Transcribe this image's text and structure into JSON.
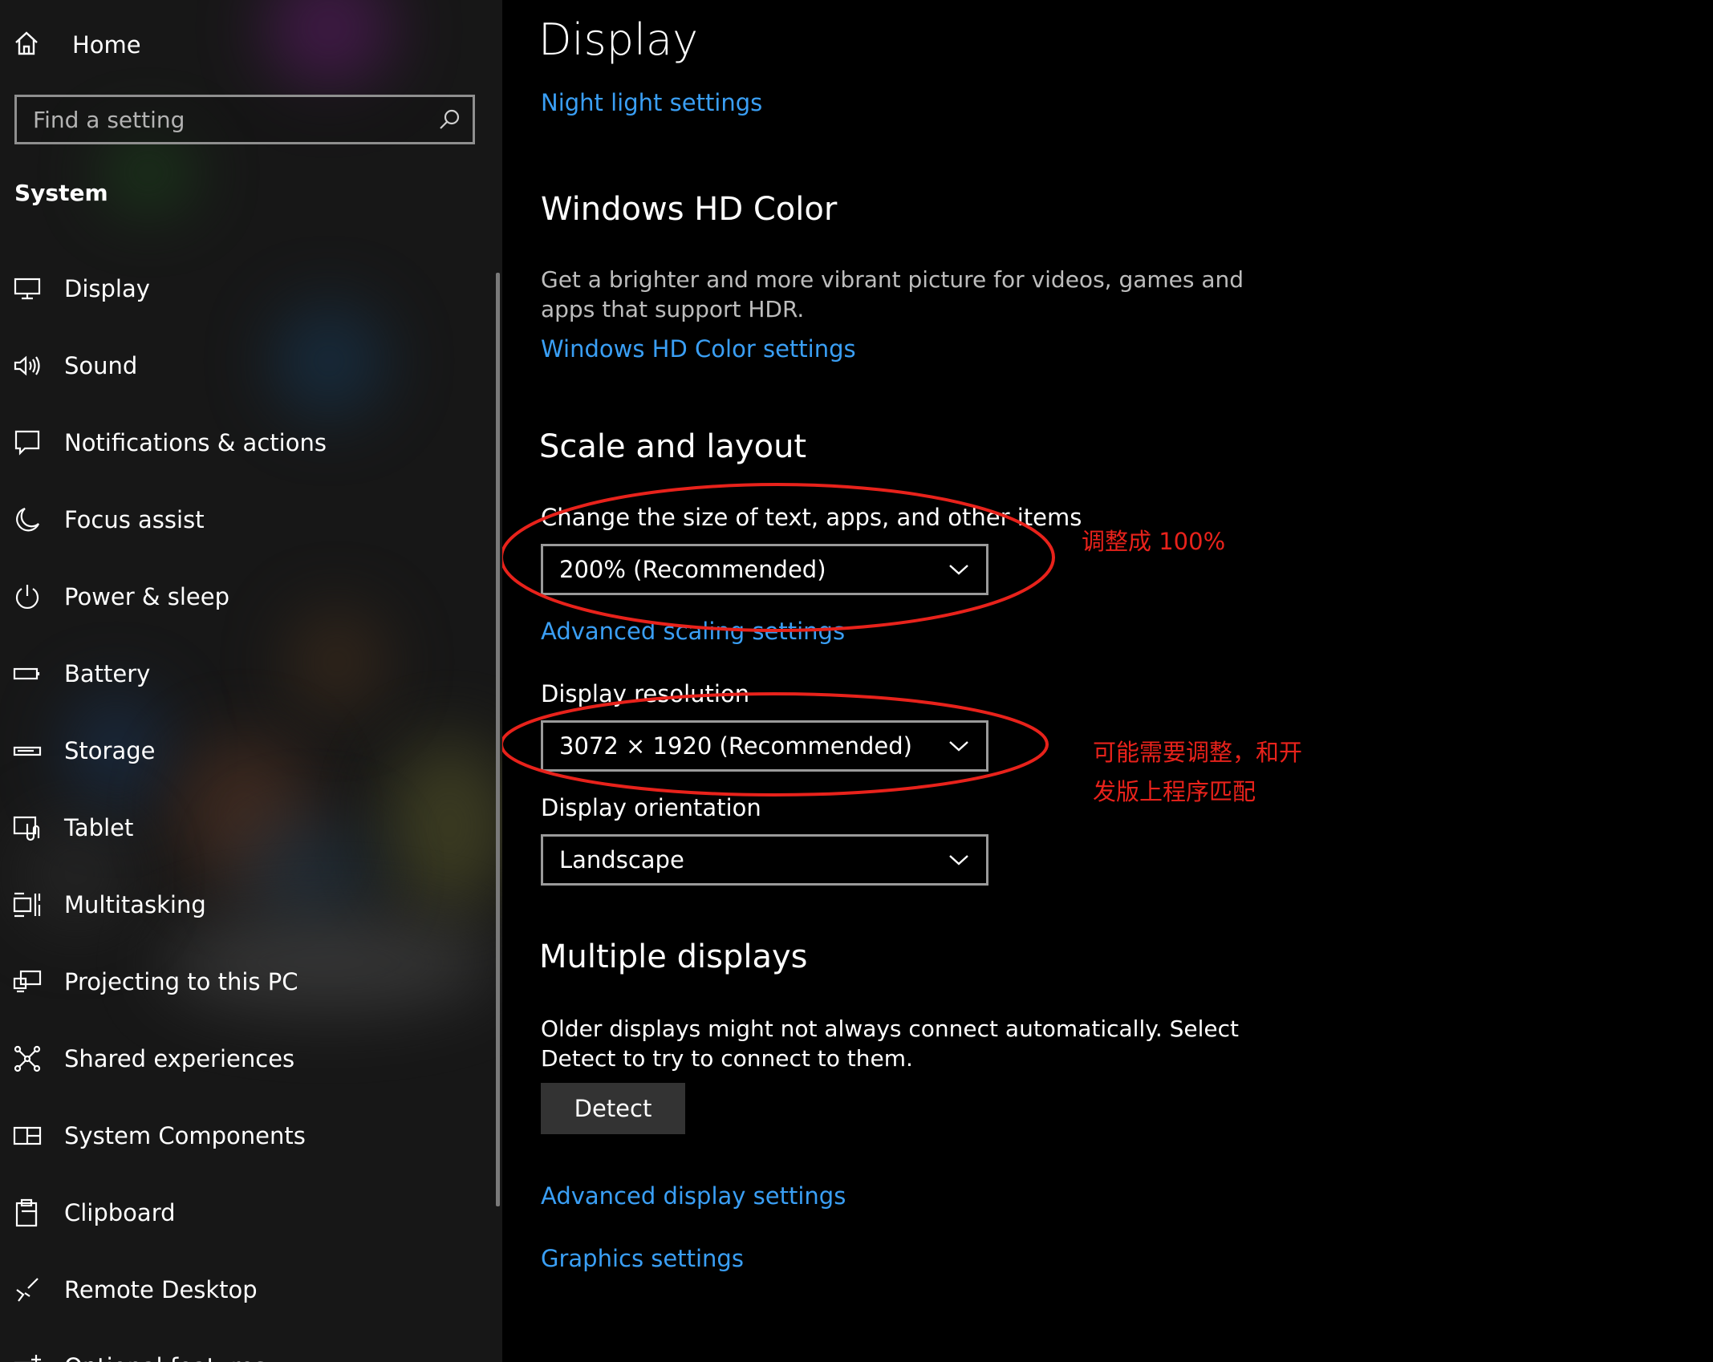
{
  "sidebar": {
    "home_label": "Home",
    "search_placeholder": "Find a setting",
    "section_title": "System",
    "items": [
      {
        "label": "Display",
        "icon": "monitor-icon"
      },
      {
        "label": "Sound",
        "icon": "speaker-icon"
      },
      {
        "label": "Notifications & actions",
        "icon": "message-icon"
      },
      {
        "label": "Focus assist",
        "icon": "moon-icon"
      },
      {
        "label": "Power & sleep",
        "icon": "power-icon"
      },
      {
        "label": "Battery",
        "icon": "battery-icon"
      },
      {
        "label": "Storage",
        "icon": "storage-icon"
      },
      {
        "label": "Tablet",
        "icon": "tablet-icon"
      },
      {
        "label": "Multitasking",
        "icon": "multitasking-icon"
      },
      {
        "label": "Projecting to this PC",
        "icon": "projecting-icon"
      },
      {
        "label": "Shared experiences",
        "icon": "shared-icon"
      },
      {
        "label": "System Components",
        "icon": "components-icon"
      },
      {
        "label": "Clipboard",
        "icon": "clipboard-icon"
      },
      {
        "label": "Remote Desktop",
        "icon": "remote-desktop-icon"
      },
      {
        "label": "Optional features",
        "icon": "optional-features-icon"
      }
    ]
  },
  "main": {
    "title": "Display",
    "night_light_link": "Night light settings",
    "hdr": {
      "heading": "Windows HD Color",
      "description": "Get a brighter and more vibrant picture for videos, games and apps that support HDR.",
      "link": "Windows HD Color settings"
    },
    "scale": {
      "heading": "Scale and layout",
      "size_label": "Change the size of text, apps, and other items",
      "size_value": "200% (Recommended)",
      "advanced_link": "Advanced scaling settings",
      "resolution_label": "Display resolution",
      "resolution_value": "3072 × 1920 (Recommended)",
      "orientation_label": "Display orientation",
      "orientation_value": "Landscape"
    },
    "multiple": {
      "heading": "Multiple displays",
      "description": "Older displays might not always connect automatically. Select Detect to try to connect to them.",
      "detect_button": "Detect",
      "advanced_display_link": "Advanced display settings",
      "graphics_link": "Graphics settings"
    }
  },
  "annotations": {
    "scale_note": "调整成 100%",
    "resolution_note_line1": "可能需要调整，和开",
    "resolution_note_line2": "发版上程序匹配",
    "color": "#e8221b"
  },
  "colors": {
    "accent_link": "#3a9ff5",
    "background": "#000000",
    "sidebar_bg": "#171717"
  }
}
